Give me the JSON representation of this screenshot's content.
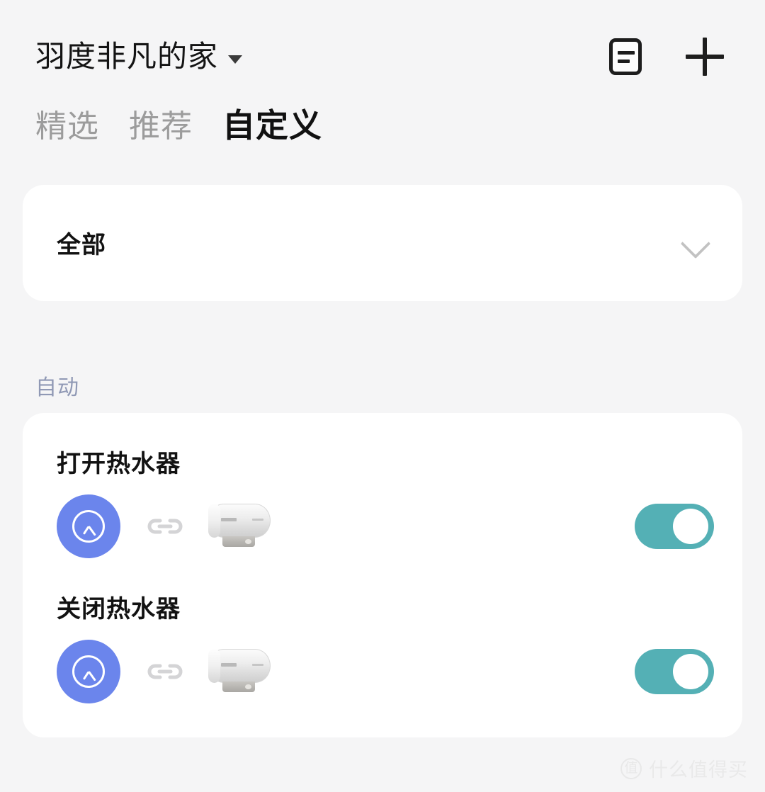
{
  "header": {
    "home_name": "羽度非凡的家",
    "dropdown_icon": "caret-down-icon",
    "log_icon": "log-list-icon",
    "add_icon": "plus-icon"
  },
  "tabs": [
    {
      "label": "精选",
      "active": false
    },
    {
      "label": "推荐",
      "active": false
    },
    {
      "label": "自定义",
      "active": true
    }
  ],
  "filter": {
    "label": "全部",
    "chevron_icon": "chevron-down-icon"
  },
  "sections": [
    {
      "label": "自动",
      "items": [
        {
          "name": "打开热水器",
          "trigger_icon": "clock-icon",
          "link_icon": "link-chain-icon",
          "device_icon": "water-heater-thumbnail",
          "enabled": true
        },
        {
          "name": "关闭热水器",
          "trigger_icon": "clock-icon",
          "link_icon": "link-chain-icon",
          "device_icon": "water-heater-thumbnail",
          "enabled": true
        }
      ]
    }
  ],
  "watermark": {
    "badge": "值",
    "text": "什么值得买"
  },
  "colors": {
    "background": "#f5f5f6",
    "card": "#ffffff",
    "accent_toggle_on": "#54b0b5",
    "trigger_blue": "#6b85ec",
    "section_label": "#9099b5",
    "tab_inactive": "#9c9c9c",
    "tab_active": "#111111"
  }
}
